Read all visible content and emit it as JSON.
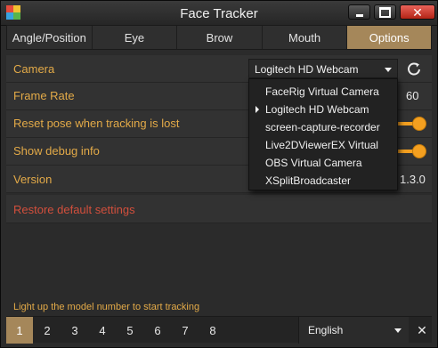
{
  "window": {
    "title": "Face Tracker",
    "close_glyph": "✕"
  },
  "tabs": [
    {
      "label": "Angle/Position"
    },
    {
      "label": "Eye"
    },
    {
      "label": "Brow"
    },
    {
      "label": "Mouth"
    },
    {
      "label": "Options",
      "active": true
    }
  ],
  "settings": {
    "camera": {
      "label": "Camera",
      "selected": "Logitech HD Webcam"
    },
    "frame_rate": {
      "label": "Frame Rate",
      "value": "60"
    },
    "reset_pose": {
      "label": "Reset pose when tracking is lost",
      "on": true
    },
    "debug": {
      "label": "Show debug info",
      "on": true
    },
    "version": {
      "label": "Version",
      "value": "1.3.0"
    },
    "restore": {
      "label": "Restore default settings"
    }
  },
  "camera_options": [
    "FaceRig Virtual Camera",
    "Logitech HD Webcam",
    "screen-capture-recorder",
    "Live2DViewerEX Virtual",
    "OBS Virtual Camera",
    "XSplitBroadcaster"
  ],
  "status": {
    "message": "Light up the model number to start tracking"
  },
  "bottom": {
    "model_numbers": [
      "1",
      "2",
      "3",
      "4",
      "5",
      "6",
      "7",
      "8"
    ],
    "active_model": "1",
    "language": "English",
    "close_glyph": "✕"
  },
  "colors": {
    "accent": "#a5875a",
    "label": "#e3aa48",
    "toggle": "#f4a020",
    "danger": "#d24f3c"
  }
}
